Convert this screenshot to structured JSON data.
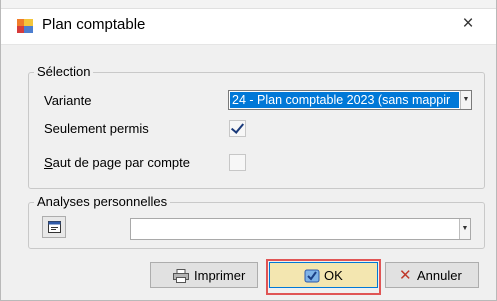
{
  "window": {
    "title": "Plan comptable",
    "close_glyph": "×"
  },
  "selection": {
    "legend": "Sélection",
    "variante_label": "Variante",
    "variante_value": "24 - Plan comptable 2023 (sans mappir",
    "seulement_permis_label": "Seulement permis",
    "seulement_permis_checked": true,
    "saut_label_first": "S",
    "saut_label_rest": "aut de page par compte",
    "saut_checked": false
  },
  "analyses": {
    "legend": "Analyses personnelles",
    "combo_value": ""
  },
  "buttons": {
    "print": "Imprimer",
    "ok": "OK",
    "cancel": "Annuler"
  },
  "colors": {
    "selection_highlight": "#0078d7",
    "focus_outline": "#e05555"
  }
}
